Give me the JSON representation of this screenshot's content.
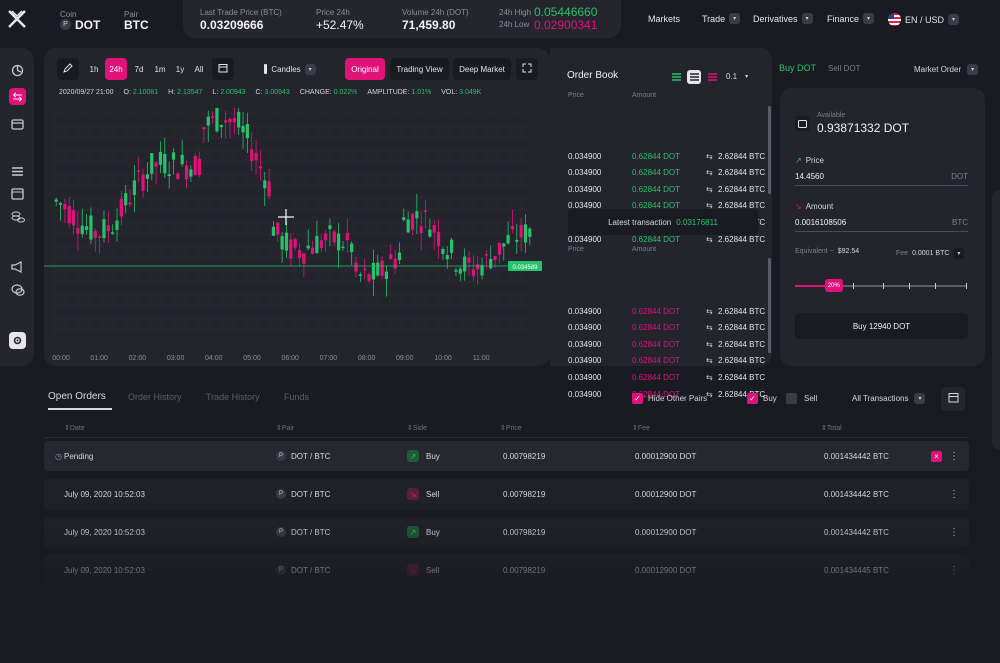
{
  "header": {
    "coin_label": "Coin",
    "coin_value": "DOT",
    "pair_label": "Pair",
    "pair_value": "BTC",
    "last_price_label": "Last Trade Price (BTC)",
    "last_price_value": "0.03209666",
    "price24_label": "Price 24h",
    "price24_value": "+52.47%",
    "volume_label": "Volume 24h (DOT)",
    "volume_value": "71,459.80",
    "high_label": "24h High",
    "high_value": "0.05446660",
    "low_label": "24h Low",
    "low_value": "0.02900341"
  },
  "nav": {
    "markets": "Markets",
    "trade": "Trade",
    "derivatives": "Derivatives",
    "finance": "Finance",
    "locale": "EN / USD"
  },
  "toolbar": {
    "intervals": [
      "1h",
      "24h",
      "7d",
      "1m",
      "1y",
      "All"
    ],
    "active_interval": "24h",
    "candles": "Candles",
    "original": "Original",
    "trading_view": "Trading View",
    "deep_market": "Deep Market"
  },
  "ohlc": {
    "date": "2020/09/27 21:00",
    "o_label": "O:",
    "o_val": "2.10081",
    "h_label": "H:",
    "h_val": "2.13547",
    "l_label": "L:",
    "l_val": "2.00943",
    "c_label": "C:",
    "c_val": "3.00943",
    "change_label": "CHANGE:",
    "change_val": "0.022%",
    "amp_label": "AMPLITUDE:",
    "amp_val": "1.01%",
    "vol_label": "VOL:",
    "vol_val": "3.049K"
  },
  "chart": {
    "price_tag": "0.034589",
    "time_labels": [
      "00:00",
      "01:00",
      "02:00",
      "03:00",
      "04:00",
      "05:00",
      "06:00",
      "07:00",
      "08:00",
      "09:00",
      "10:00",
      "11:00"
    ],
    "up_color": "#27c26c",
    "down_color": "#e0127a"
  },
  "orderbook": {
    "title": "Order Book",
    "precision": "0.1",
    "col_price": "Price",
    "col_amount": "Amount",
    "latest_label": "Latest transaction",
    "latest_value": "0.03176811",
    "buy_rows": [
      {
        "price": "0.034900",
        "amount": "0.62844 DOT",
        "total": "2.62844 BTC"
      },
      {
        "price": "0.034900",
        "amount": "0.62844 DOT",
        "total": "2.62844 BTC"
      },
      {
        "price": "0.034900",
        "amount": "0.62844 DOT",
        "total": "2.62844 BTC"
      },
      {
        "price": "0.034900",
        "amount": "0.62844 DOT",
        "total": "2.62844 BTC"
      },
      {
        "price": "0.034900",
        "amount": "0.62844 DOT",
        "total": "2.62844 BTC"
      },
      {
        "price": "0.034900",
        "amount": "0.62844 DOT",
        "total": "2.62844 BTC"
      }
    ],
    "sell_rows": [
      {
        "price": "0.034900",
        "amount": "0.62844 DOT",
        "total": "2.62844 BTC"
      },
      {
        "price": "0.034900",
        "amount": "0.62844 DOT",
        "total": "2.62844 BTC"
      },
      {
        "price": "0.034900",
        "amount": "0.62844 DOT",
        "total": "2.62844 BTC"
      },
      {
        "price": "0.034900",
        "amount": "0.62844 DOT",
        "total": "2.62844 BTC"
      },
      {
        "price": "0.034900",
        "amount": "0.62844 DOT",
        "total": "2.62844 BTC"
      },
      {
        "price": "0.034900",
        "amount": "0.62844 DOT",
        "total": "2.62844 BTC"
      }
    ]
  },
  "trade": {
    "buy_tab": "Buy DOT",
    "sell_tab": "Sell DOT",
    "order_type": "Market Order",
    "available_label": "Available",
    "available_value": "0.93871332 DOT",
    "price_label": "Price",
    "price_value": "14.4560",
    "price_unit": "DOT",
    "amount_label": "Amount",
    "amount_value": "0.0016108506",
    "amount_unit": "BTC",
    "equivalent_label": "Equivalent ~",
    "equivalent_value": "$92.54",
    "fee_label": "Fee",
    "fee_value": "0.0001 BTC",
    "slider_label": "20%",
    "slider_fraction": 0.2,
    "submit": "Buy 12940 DOT"
  },
  "orders": {
    "tabs": [
      "Open Orders",
      "Order History",
      "Trade History",
      "Funds"
    ],
    "hide_pairs": "Hide Other Pairs",
    "buy": "Buy",
    "sell": "Sell",
    "filter": "All Transactions",
    "columns": [
      "Date",
      "Pair",
      "Side",
      "Price",
      "Fee",
      "Total"
    ],
    "rows": [
      {
        "date": "Pending",
        "pair": "DOT / BTC",
        "side": "Buy",
        "price": "0.00798219",
        "fee": "0.00012900 DOT",
        "total": "0.001434442 BTC"
      },
      {
        "date": "July 09, 2020 10:52:03",
        "pair": "DOT / BTC",
        "side": "Sell",
        "price": "0.00798219",
        "fee": "0.00012900 DOT",
        "total": "0.001434442 BTC"
      },
      {
        "date": "July 09, 2020 10:52:03",
        "pair": "DOT / BTC",
        "side": "Buy",
        "price": "0.00798219",
        "fee": "0.00012900 DOT",
        "total": "0.001434442 BTC"
      },
      {
        "date": "July 09, 2020 10:52:03",
        "pair": "DOT / BTC",
        "side": "Sell",
        "price": "0.00798219",
        "fee": "0.00012900 DOT",
        "total": "0.001434445 BTC"
      }
    ]
  }
}
